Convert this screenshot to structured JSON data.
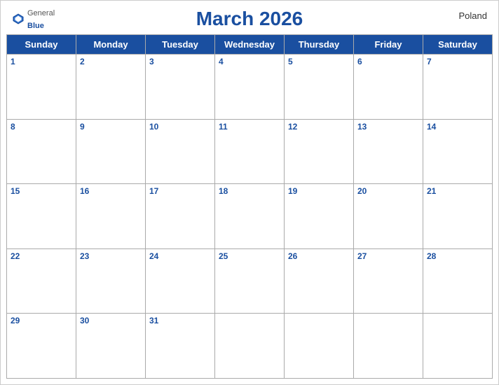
{
  "header": {
    "title": "March 2026",
    "country": "Poland",
    "logo": {
      "general": "General",
      "blue": "Blue"
    }
  },
  "days_of_week": [
    "Sunday",
    "Monday",
    "Tuesday",
    "Wednesday",
    "Thursday",
    "Friday",
    "Saturday"
  ],
  "weeks": [
    [
      {
        "date": "1",
        "empty": false
      },
      {
        "date": "2",
        "empty": false
      },
      {
        "date": "3",
        "empty": false
      },
      {
        "date": "4",
        "empty": false
      },
      {
        "date": "5",
        "empty": false
      },
      {
        "date": "6",
        "empty": false
      },
      {
        "date": "7",
        "empty": false
      }
    ],
    [
      {
        "date": "8",
        "empty": false
      },
      {
        "date": "9",
        "empty": false
      },
      {
        "date": "10",
        "empty": false
      },
      {
        "date": "11",
        "empty": false
      },
      {
        "date": "12",
        "empty": false
      },
      {
        "date": "13",
        "empty": false
      },
      {
        "date": "14",
        "empty": false
      }
    ],
    [
      {
        "date": "15",
        "empty": false
      },
      {
        "date": "16",
        "empty": false
      },
      {
        "date": "17",
        "empty": false
      },
      {
        "date": "18",
        "empty": false
      },
      {
        "date": "19",
        "empty": false
      },
      {
        "date": "20",
        "empty": false
      },
      {
        "date": "21",
        "empty": false
      }
    ],
    [
      {
        "date": "22",
        "empty": false
      },
      {
        "date": "23",
        "empty": false
      },
      {
        "date": "24",
        "empty": false
      },
      {
        "date": "25",
        "empty": false
      },
      {
        "date": "26",
        "empty": false
      },
      {
        "date": "27",
        "empty": false
      },
      {
        "date": "28",
        "empty": false
      }
    ],
    [
      {
        "date": "29",
        "empty": false
      },
      {
        "date": "30",
        "empty": false
      },
      {
        "date": "31",
        "empty": false
      },
      {
        "date": "",
        "empty": true
      },
      {
        "date": "",
        "empty": true
      },
      {
        "date": "",
        "empty": true
      },
      {
        "date": "",
        "empty": true
      }
    ]
  ],
  "colors": {
    "header_bg": "#1a4fa0",
    "header_text": "#ffffff",
    "date_text": "#1a4fa0",
    "border": "#aaaaaa"
  }
}
